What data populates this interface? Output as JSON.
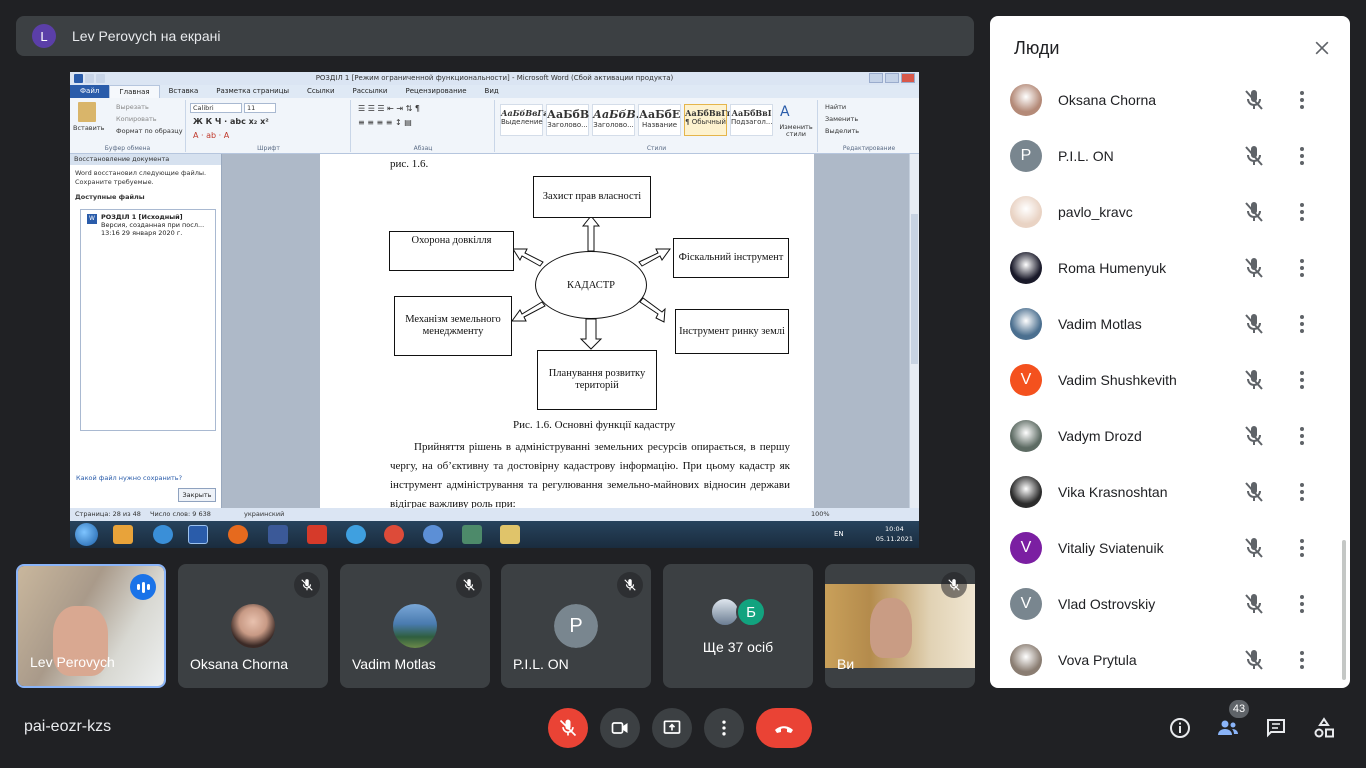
{
  "banner": {
    "avatar_letter": "L",
    "text": "Lev Perovych на екрані"
  },
  "word": {
    "title": "РОЗДІЛ 1 [Режим ограниченной функциональности] - Microsoft Word (Сбой активации продукта)",
    "tabs": [
      "Файл",
      "Главная",
      "Вставка",
      "Разметка страницы",
      "Ссылки",
      "Рассылки",
      "Рецензирование",
      "Вид"
    ],
    "clipboard": {
      "paste": "Вставить",
      "cut": "Вырезать",
      "copy": "Копировать",
      "format": "Формат по образцу",
      "group": "Буфер обмена"
    },
    "font": {
      "name": "Calibri",
      "size": "11",
      "group": "Шрифт"
    },
    "paragraph_group": "Абзац",
    "styles": [
      {
        "sample": "АаБбВвГг",
        "label": "Выделение"
      },
      {
        "sample": "АаБбВ",
        "label": "Заголово..."
      },
      {
        "sample": "АаБбВ.",
        "label": "Заголово..."
      },
      {
        "sample": "АаБбЕ",
        "label": "Название"
      },
      {
        "sample": "АаБбВвГг,",
        "label": "¶ Обычный"
      },
      {
        "sample": "АаБбВвІ",
        "label": "Подзагол..."
      }
    ],
    "styles_group": "Стили",
    "change_styles": "Изменить стили",
    "editing": {
      "find": "Найти",
      "replace": "Заменить",
      "select": "Выделить",
      "group": "Редактирование"
    },
    "recovery": {
      "header": "Восстановление документа",
      "text": "Word восстановил следующие файлы. Сохраните требуемые.",
      "available": "Доступные файлы",
      "file_name": "РОЗДІЛ 1 [Исходный]",
      "file_version": "Версия, созданная при посл...",
      "file_date": "13:16 29 января 2020 г.",
      "question": "Какой файл нужно сохранить?",
      "close": "Закрыть"
    },
    "doc": {
      "top_line": "рис. 1.6.",
      "center": "КАДАСТР",
      "boxes": {
        "top": "Захист прав власності",
        "left_top": "Охорона довкілля",
        "right_top": "Фіскальний інструмент",
        "left_bottom": "Механізм земельного менеджменту",
        "right_bottom": "Інструмент ринку землі",
        "bottom": "Планування розвитку територій"
      },
      "caption": "Рис. 1.6. Основні функції кадастру",
      "paragraph": "Прийняття рішень в адмініструванні земельних ресурсів опирається, в першу чергу, на об’єктивну та достовірну кадастрову інформацію. При цьому кадастр як інструмент адміністрування та регулювання земельно-майнових відносин держави відіграє важливу роль при:"
    },
    "status": {
      "page": "Страница: 28 из 48",
      "words": "Число слов: 9 638",
      "lang": "украинский",
      "zoom": "100%"
    },
    "taskbar": {
      "lang": "EN",
      "time": "10:04",
      "date": "05.11.2021"
    }
  },
  "tiles": [
    {
      "name": "Lev Perovych",
      "speaking": true
    },
    {
      "name": "Oksana Chorna",
      "muted": true
    },
    {
      "name": "Vadim Motlas",
      "muted": true
    },
    {
      "name": "P.I.L. ON",
      "letter": "P",
      "muted": true
    },
    {
      "name": "Ще 37 осіб",
      "letter": "Б"
    },
    {
      "name": "Ви",
      "muted": true
    }
  ],
  "meeting_code": "pai-eozr-kzs",
  "participants_count": "43",
  "panel": {
    "title": "Люди",
    "people": [
      {
        "name": "Oksana Chorna",
        "avatar": "photo",
        "color": "#b48a78"
      },
      {
        "name": "P.I.L. ON",
        "avatar": "P",
        "color": "#79868f"
      },
      {
        "name": "pavlo_kravc",
        "avatar": "photo",
        "color": "#e9d3c4"
      },
      {
        "name": "Roma Humenyuk",
        "avatar": "photo",
        "color": "#1a1a2a"
      },
      {
        "name": "Vadim Motlas",
        "avatar": "photo",
        "color": "#4b6f8f"
      },
      {
        "name": "Vadim Shushkevith",
        "avatar": "V",
        "color": "#f4511e"
      },
      {
        "name": "Vadym Drozd",
        "avatar": "photo",
        "color": "#5d6b63"
      },
      {
        "name": "Vika Krasnoshtan",
        "avatar": "photo",
        "color": "#2c2c2c"
      },
      {
        "name": "Vitaliy Sviatenuik",
        "avatar": "V",
        "color": "#7b1fa2"
      },
      {
        "name": "Vlad Ostrovskiy",
        "avatar": "V",
        "color": "#79868f"
      },
      {
        "name": "Vova Prytula",
        "avatar": "photo",
        "color": "#8a7d72"
      }
    ]
  }
}
